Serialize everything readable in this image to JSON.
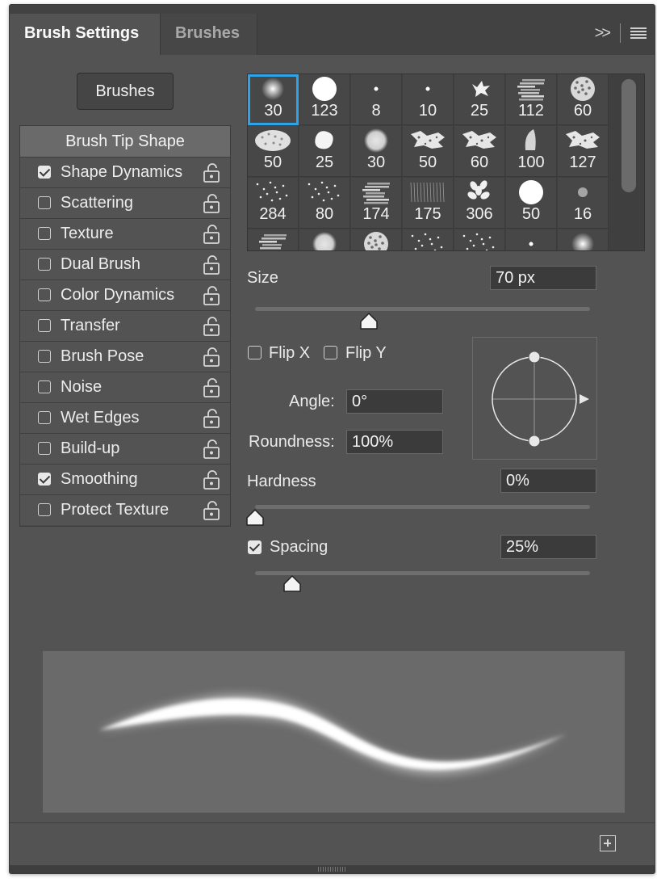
{
  "tabs": [
    {
      "label": "Brush Settings",
      "active": true
    },
    {
      "label": "Brushes",
      "active": false
    }
  ],
  "panel_tools": {
    "expand_icon": "double-chevron-right-icon",
    "menu_icon": "hamburger-menu-icon"
  },
  "brushes_button": "Brushes",
  "options_header": "Brush Tip Shape",
  "options": [
    {
      "label": "Shape Dynamics",
      "checked": true
    },
    {
      "label": "Scattering",
      "checked": false
    },
    {
      "label": "Texture",
      "checked": false
    },
    {
      "label": "Dual Brush",
      "checked": false
    },
    {
      "label": "Color Dynamics",
      "checked": false
    },
    {
      "label": "Transfer",
      "checked": false
    },
    {
      "label": "Brush Pose",
      "checked": false
    },
    {
      "label": "Noise",
      "checked": false
    },
    {
      "label": "Wet Edges",
      "checked": false
    },
    {
      "label": "Build-up",
      "checked": false
    },
    {
      "label": "Smoothing",
      "checked": true
    },
    {
      "label": "Protect Texture",
      "checked": false
    }
  ],
  "presets": [
    {
      "size": "30",
      "shape": "soft"
    },
    {
      "size": "123",
      "shape": "hard"
    },
    {
      "size": "8",
      "shape": "dot"
    },
    {
      "size": "10",
      "shape": "dot"
    },
    {
      "size": "25",
      "shape": "splat"
    },
    {
      "size": "112",
      "shape": "chalk"
    },
    {
      "size": "60",
      "shape": "sponge"
    },
    {
      "size": "50",
      "shape": "sponge-wide"
    },
    {
      "size": "25",
      "shape": "blob"
    },
    {
      "size": "30",
      "shape": "fuzzy"
    },
    {
      "size": "50",
      "shape": "rough"
    },
    {
      "size": "60",
      "shape": "rough"
    },
    {
      "size": "100",
      "shape": "leaf"
    },
    {
      "size": "127",
      "shape": "rough"
    },
    {
      "size": "284",
      "shape": "spatter"
    },
    {
      "size": "80",
      "shape": "spatter"
    },
    {
      "size": "174",
      "shape": "chalk"
    },
    {
      "size": "175",
      "shape": "grass"
    },
    {
      "size": "306",
      "shape": "leaves"
    },
    {
      "size": "50",
      "shape": "hard"
    },
    {
      "size": "16",
      "shape": "fuzzy-small"
    },
    {
      "size": "",
      "shape": "chalk"
    },
    {
      "size": "",
      "shape": "fuzzy"
    },
    {
      "size": "",
      "shape": "sponge"
    },
    {
      "size": "",
      "shape": "spatter"
    },
    {
      "size": "",
      "shape": "spatter"
    },
    {
      "size": "",
      "shape": "dot"
    },
    {
      "size": "",
      "shape": "soft"
    }
  ],
  "selected_preset_index": 0,
  "size": {
    "label": "Size",
    "value": "70 px",
    "slider_fraction": 0.34
  },
  "flip_x": {
    "label": "Flip X",
    "checked": false
  },
  "flip_y": {
    "label": "Flip Y",
    "checked": false
  },
  "angle": {
    "label": "Angle:",
    "value": "0°"
  },
  "roundness": {
    "label": "Roundness:",
    "value": "100%"
  },
  "hardness": {
    "label": "Hardness",
    "value": "0%",
    "slider_fraction": 0.0
  },
  "spacing": {
    "label": "Spacing",
    "value": "25%",
    "checked": true,
    "slider_fraction": 0.11
  },
  "footer": {
    "new_icon": "new-brush-icon"
  },
  "colors": {
    "panel": "#535353",
    "selection": "#2fa3e8",
    "preview_bg": "#6a6a6a"
  }
}
